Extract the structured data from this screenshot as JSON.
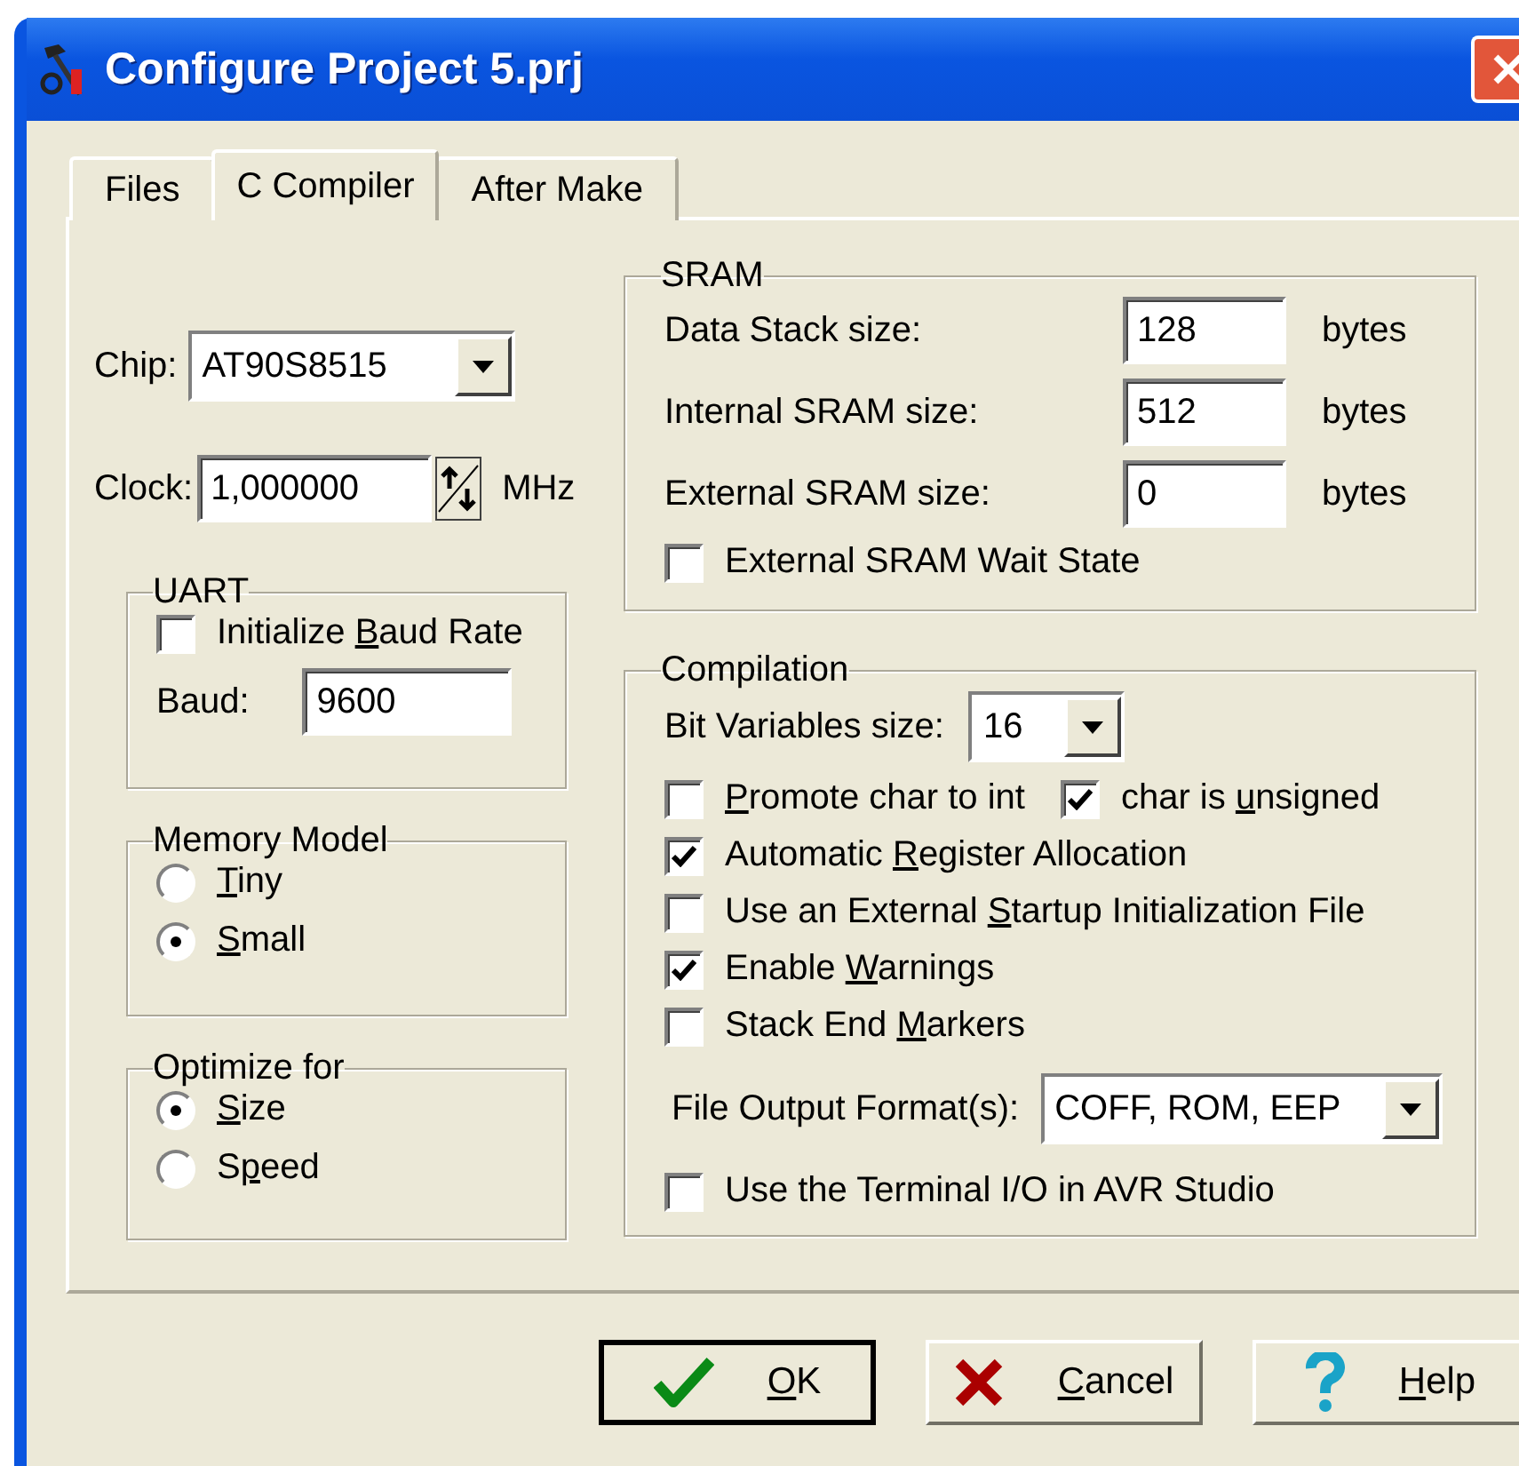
{
  "window": {
    "title": "Configure Project 5.prj"
  },
  "tabs": [
    {
      "label": "Files",
      "selected": false
    },
    {
      "label": "C Compiler",
      "selected": true
    },
    {
      "label": "After Make",
      "selected": false
    }
  ],
  "chip": {
    "label": "Chip:",
    "value": "AT90S8515"
  },
  "clock": {
    "label": "Clock:",
    "value": "1,000000",
    "unit": "MHz"
  },
  "uart": {
    "title": "UART",
    "checkbox": {
      "label": {
        "pre": "Initialize ",
        "key": "B",
        "post": "aud Rate"
      },
      "checked": false
    },
    "baud": {
      "label": "Baud:",
      "value": "9600"
    }
  },
  "memory_model": {
    "title": "Memory Model",
    "options": [
      {
        "label": {
          "key": "T",
          "post": "iny"
        },
        "selected": false
      },
      {
        "label": {
          "key": "S",
          "post": "mall"
        },
        "selected": true
      }
    ]
  },
  "optimize_for": {
    "title": "Optimize for",
    "options": [
      {
        "label": {
          "key": "S",
          "post": "ize"
        },
        "selected": true
      },
      {
        "label": {
          "pre": "S",
          "key": "p",
          "post": "eed"
        },
        "selected": false
      }
    ]
  },
  "sram": {
    "title": "SRAM",
    "fields": [
      {
        "label": "Data Stack size:",
        "value": "128",
        "unit": "bytes"
      },
      {
        "label": "Internal SRAM size:",
        "value": "512",
        "unit": "bytes"
      },
      {
        "label": "External SRAM size:",
        "value": "0",
        "unit": "bytes"
      }
    ],
    "wait_state": {
      "label": {
        "pre": "External SRAM Wait State"
      },
      "checked": false
    }
  },
  "compilation": {
    "title": "Compilation",
    "bit_variables": {
      "label": "Bit Variables size:",
      "value": "16"
    },
    "rows": [
      {
        "kind": "checks",
        "checks": [
          {
            "label": {
              "key": "P",
              "post": "romote char to int"
            },
            "checked": false
          },
          {
            "label": {
              "pre": "char is ",
              "key": "u",
              "post": "nsigned"
            },
            "checked": true
          }
        ]
      },
      {
        "kind": "checks",
        "checks": [
          {
            "label": {
              "pre": "Automatic ",
              "key": "R",
              "post": "egister Allocation"
            },
            "checked": true
          }
        ]
      },
      {
        "kind": "checks",
        "checks": [
          {
            "label": {
              "pre": "Use an External ",
              "key": "S",
              "post": "tartup Initialization File"
            },
            "checked": false
          }
        ]
      },
      {
        "kind": "checks",
        "checks": [
          {
            "label": {
              "pre": "Enable ",
              "key": "W",
              "post": "arnings"
            },
            "checked": true
          }
        ]
      },
      {
        "kind": "checks",
        "checks": [
          {
            "label": {
              "pre": "Stack End ",
              "key": "M",
              "post": "arkers"
            },
            "checked": false
          }
        ]
      },
      {
        "kind": "dropdown",
        "label": "File Output Format(s):",
        "value": "COFF, ROM, EEP"
      },
      {
        "kind": "checks",
        "checks": [
          {
            "label": {
              "pre": "Use the Terminal I/O in AVR Studio"
            },
            "checked": false
          }
        ]
      }
    ]
  },
  "buttons": [
    {
      "kind": "ok",
      "label": {
        "key": "O",
        "post": "K"
      },
      "default": true
    },
    {
      "kind": "cancel",
      "label": {
        "key": "C",
        "post": "ancel"
      },
      "default": false
    },
    {
      "kind": "help",
      "label": {
        "key": "H",
        "post": "elp"
      },
      "default": false
    }
  ]
}
